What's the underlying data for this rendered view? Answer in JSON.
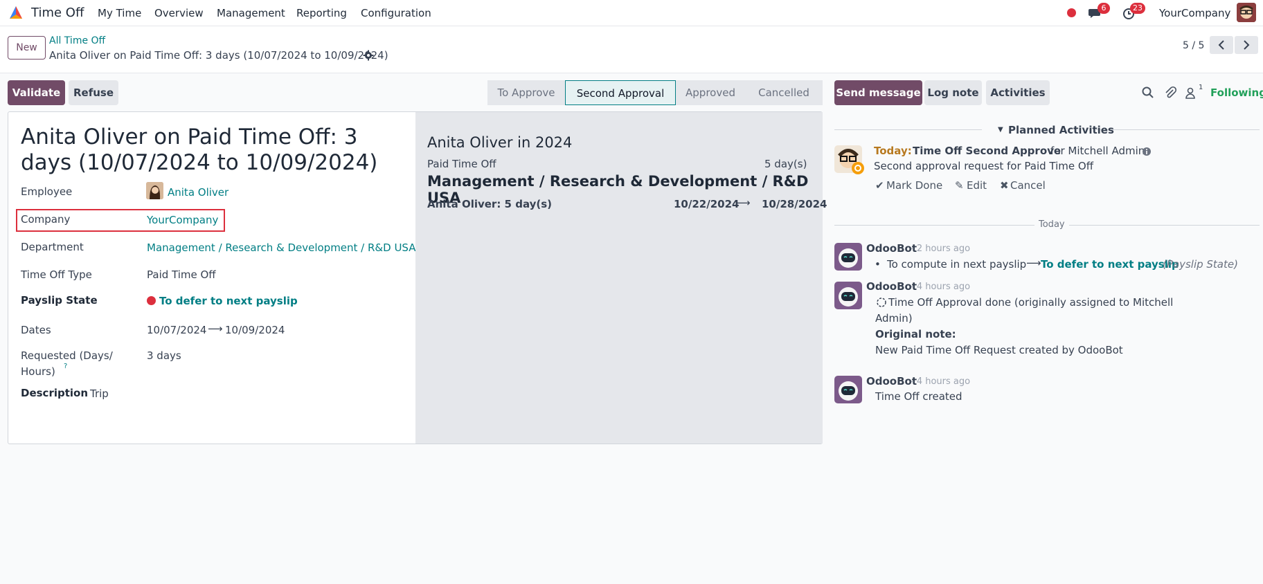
{
  "navbar": {
    "app_name": "Time Off",
    "menus": [
      "My Time",
      "Overview",
      "Management",
      "Reporting",
      "Configuration"
    ],
    "messages_badge": "6",
    "activities_badge": "23",
    "company": "YourCompany"
  },
  "control_panel": {
    "new_label": "New",
    "breadcrumb_parent": "All Time Off",
    "breadcrumb_current": "Anita Oliver on Paid Time Off: 3 days (10/07/2024 to 10/09/2024)",
    "pager": "5 / 5"
  },
  "form_header": {
    "validate_label": "Validate",
    "refuse_label": "Refuse",
    "stages": [
      "To Approve",
      "Second Approval",
      "Approved",
      "Cancelled"
    ],
    "active_stage": "Second Approval"
  },
  "form": {
    "title": "Anita Oliver on Paid Time Off: 3 days (10/07/2024 to 10/09/2024)",
    "employee_label": "Employee",
    "employee_value": "Anita Oliver",
    "company_label": "Company",
    "company_value": "YourCompany",
    "department_label": "Department",
    "department_value": "Management / Research & Development / R&D USA",
    "type_label": "Time Off Type",
    "type_value": "Paid Time Off",
    "payslip_label": "Payslip State",
    "payslip_value": "To defer to next payslip",
    "dates_label": "Dates",
    "date_from": "10/07/2024",
    "date_to": "10/09/2024",
    "requested_label_1": "Requested (Days/",
    "requested_label_2": "Hours)",
    "requested_help": "?",
    "requested_value": "3 days",
    "description_label": "Description",
    "description_value": "Trip"
  },
  "summary": {
    "title": "Anita Oliver in 2024",
    "type": "Paid Time Off",
    "type_days": "5 day(s)",
    "department": "Management / Research & Development / R&D USA",
    "person_line": "Anita Oliver: 5 day(s)",
    "range_from": "10/22/2024",
    "range_to": "10/28/2024"
  },
  "chatter": {
    "send_message_label": "Send message",
    "log_note_label": "Log note",
    "activities_label": "Activities",
    "followers_count": "1",
    "following_label": "Following",
    "planned_label": "Planned Activities",
    "activity": {
      "today_label": "Today:",
      "name": "Time Off Second Approve",
      "assignee": "for Mitchell Admin",
      "note": "Second approval request for Paid Time Off",
      "mark_done": "Mark Done",
      "edit": "Edit",
      "cancel": "Cancel"
    },
    "today_separator": "Today",
    "messages": [
      {
        "author": "OdooBot",
        "time": "- 2 hours ago",
        "bullet_old": "To compute in next payslip",
        "bullet_new": "To defer to next payslip",
        "bullet_field": "(Payslip State)"
      },
      {
        "author": "OdooBot",
        "time": "- 4 hours ago",
        "line1": "Time Off Approval done (originally assigned to Mitchell",
        "line2": "Admin)",
        "note_label": "Original note:",
        "note_text": "New Paid Time Off Request created by OdooBot"
      },
      {
        "author": "OdooBot",
        "time": "- 4 hours ago",
        "text": "Time Off created"
      }
    ]
  },
  "colors": {
    "brand": "#714b67",
    "link": "#017e84",
    "danger": "#dc2f3d",
    "success": "#22a05a",
    "warning": "#b7791f"
  }
}
